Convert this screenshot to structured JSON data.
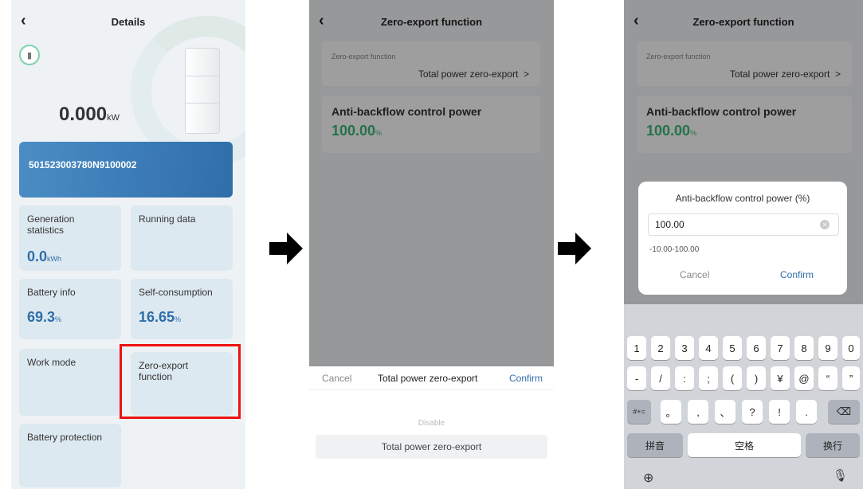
{
  "screen1": {
    "title": "Details",
    "power_value": "0.000",
    "power_unit": "kW",
    "serial": "501523003780N9100002",
    "cards": [
      {
        "title": "Generation statistics",
        "value": "0.0",
        "unit": "kWh"
      },
      {
        "title": "Running data",
        "value": "",
        "unit": ""
      },
      {
        "title": "Battery info",
        "value": "69.3",
        "unit": "%"
      },
      {
        "title": "Self-consumption",
        "value": "16.65",
        "unit": "%"
      },
      {
        "title": "Work mode",
        "value": "",
        "unit": ""
      },
      {
        "title": "Zero-export function",
        "value": "",
        "unit": ""
      },
      {
        "title": "Battery protection",
        "value": "",
        "unit": ""
      }
    ]
  },
  "screen2": {
    "title": "Zero-export function",
    "field_label": "Zero-export function",
    "field_value": "Total power zero-export",
    "chevron": ">",
    "power_label": "Anti-backflow control power",
    "power_value": "100.00",
    "power_unit": "%",
    "picker": {
      "cancel": "Cancel",
      "title": "Total power zero-export",
      "confirm": "Confirm",
      "options": [
        "Disable",
        "Total power zero-export"
      ]
    }
  },
  "screen3": {
    "title": "Zero-export function",
    "field_label": "Zero-export function",
    "field_value": "Total power zero-export",
    "chevron": ">",
    "power_label": "Anti-backflow control power",
    "power_value": "100.00",
    "power_unit": "%",
    "dialog": {
      "title": "Anti-backflow control power  (%)",
      "input_value": "100.00",
      "range": "-10.00-100.00",
      "cancel": "Cancel",
      "confirm": "Confirm"
    },
    "keyboard": {
      "row1": [
        "1",
        "2",
        "3",
        "4",
        "5",
        "6",
        "7",
        "8",
        "9",
        "0"
      ],
      "row2": [
        "-",
        "/",
        ":",
        ";",
        "(",
        ")",
        "¥",
        "@",
        "“",
        "”"
      ],
      "row3": [
        "#+=",
        "。",
        ",",
        "、",
        "?",
        "!",
        "."
      ],
      "bottom": [
        "拼音",
        "空格",
        "换行"
      ]
    }
  },
  "colors": {
    "accent": "#2f6ea9",
    "green": "#3cb97a",
    "highlight": "#ee1111"
  }
}
